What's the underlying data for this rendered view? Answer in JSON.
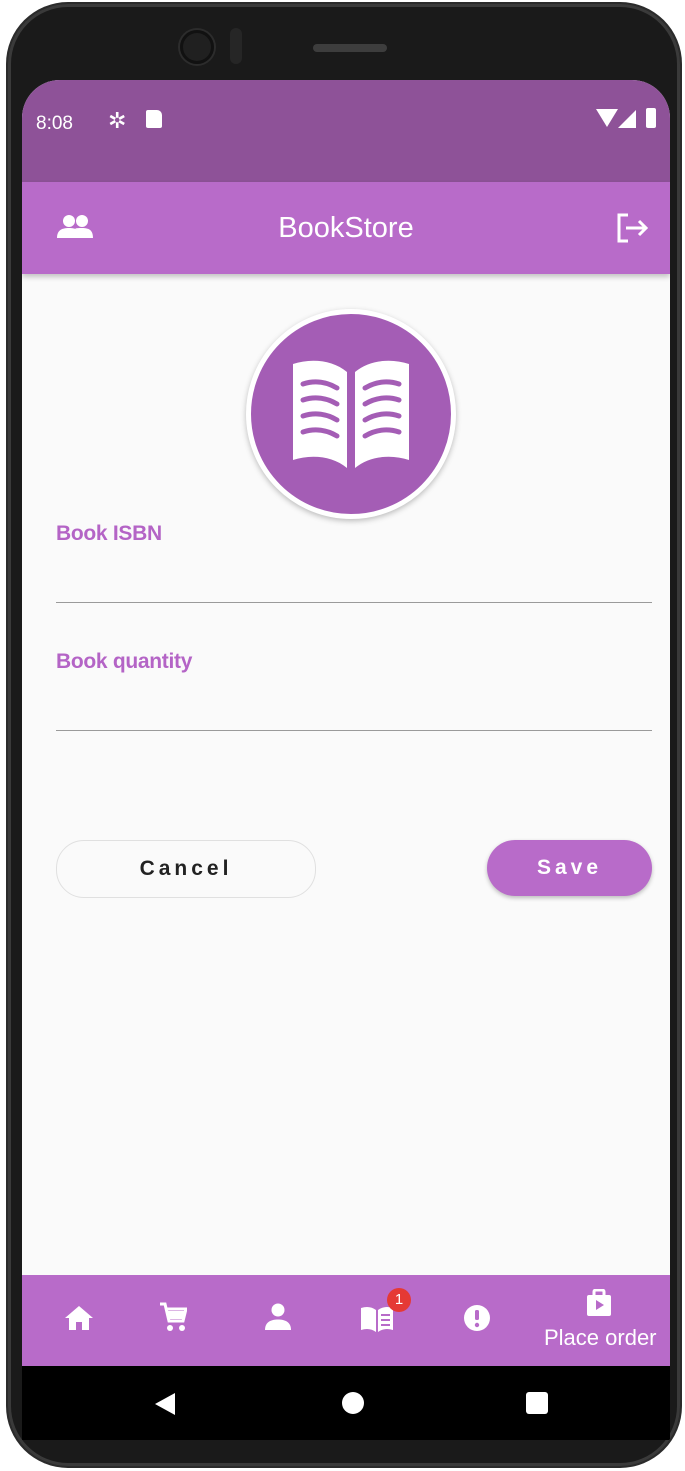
{
  "status_bar": {
    "time": "8:08"
  },
  "app_bar": {
    "title": "BookStore"
  },
  "form": {
    "isbn_label": "Book ISBN",
    "isbn_value": "",
    "quantity_label": "Book quantity",
    "quantity_value": ""
  },
  "buttons": {
    "cancel": "Cancel",
    "save": "Save"
  },
  "bottom_nav": {
    "items": [
      {
        "icon": "home-icon"
      },
      {
        "icon": "cart-icon"
      },
      {
        "icon": "person-icon"
      },
      {
        "icon": "book-open-icon",
        "badge": "1"
      },
      {
        "icon": "alert-icon"
      },
      {
        "icon": "shopping-bag-icon",
        "label": "Place order"
      }
    ]
  },
  "colors": {
    "primary": "#b86bc9",
    "status_bar": "#8e5298",
    "badge": "#e53935",
    "background": "#fafafa"
  }
}
